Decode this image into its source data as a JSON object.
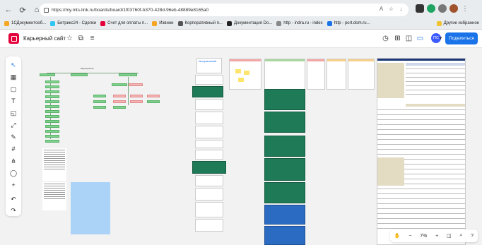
{
  "browser": {
    "url": "https://my.mts-link.ru/boards/board/1f03760f-b370-428d-96eb-48889e8165a0",
    "bookmarks": [
      {
        "label": "1СДокументооб...",
        "color": "#f5a623"
      },
      {
        "label": "Битрикс24 - Сделки",
        "color": "#2fc6f6"
      },
      {
        "label": "Счет для оплаты п...",
        "color": "#e4003a"
      },
      {
        "label": "Извини",
        "color": "#f5a623"
      },
      {
        "label": "Корпоративный п...",
        "color": "#555555"
      },
      {
        "label": "Документация Dо...",
        "color": "#222222"
      },
      {
        "label": "http - indra.ru - index",
        "color": "#888888"
      },
      {
        "label": "http - port.dom.ru...",
        "color": "#1a73e8"
      }
    ],
    "other_bookmarks": "Другие избранное"
  },
  "app": {
    "board_title": "Карьерный сайт",
    "share_label": "Поделиться",
    "avatar_initials": "ПС"
  },
  "canvas": {
    "mindmap_title": "Мероприятие",
    "card_title": "Интерактивный",
    "zoom_level": "7%"
  },
  "colors": {
    "accent": "#e4003a",
    "share": "#1a73e8",
    "green_frame": "#1f7a57",
    "blue_frame": "#2b6bc2",
    "mindmap_node": "#7ed08c"
  }
}
